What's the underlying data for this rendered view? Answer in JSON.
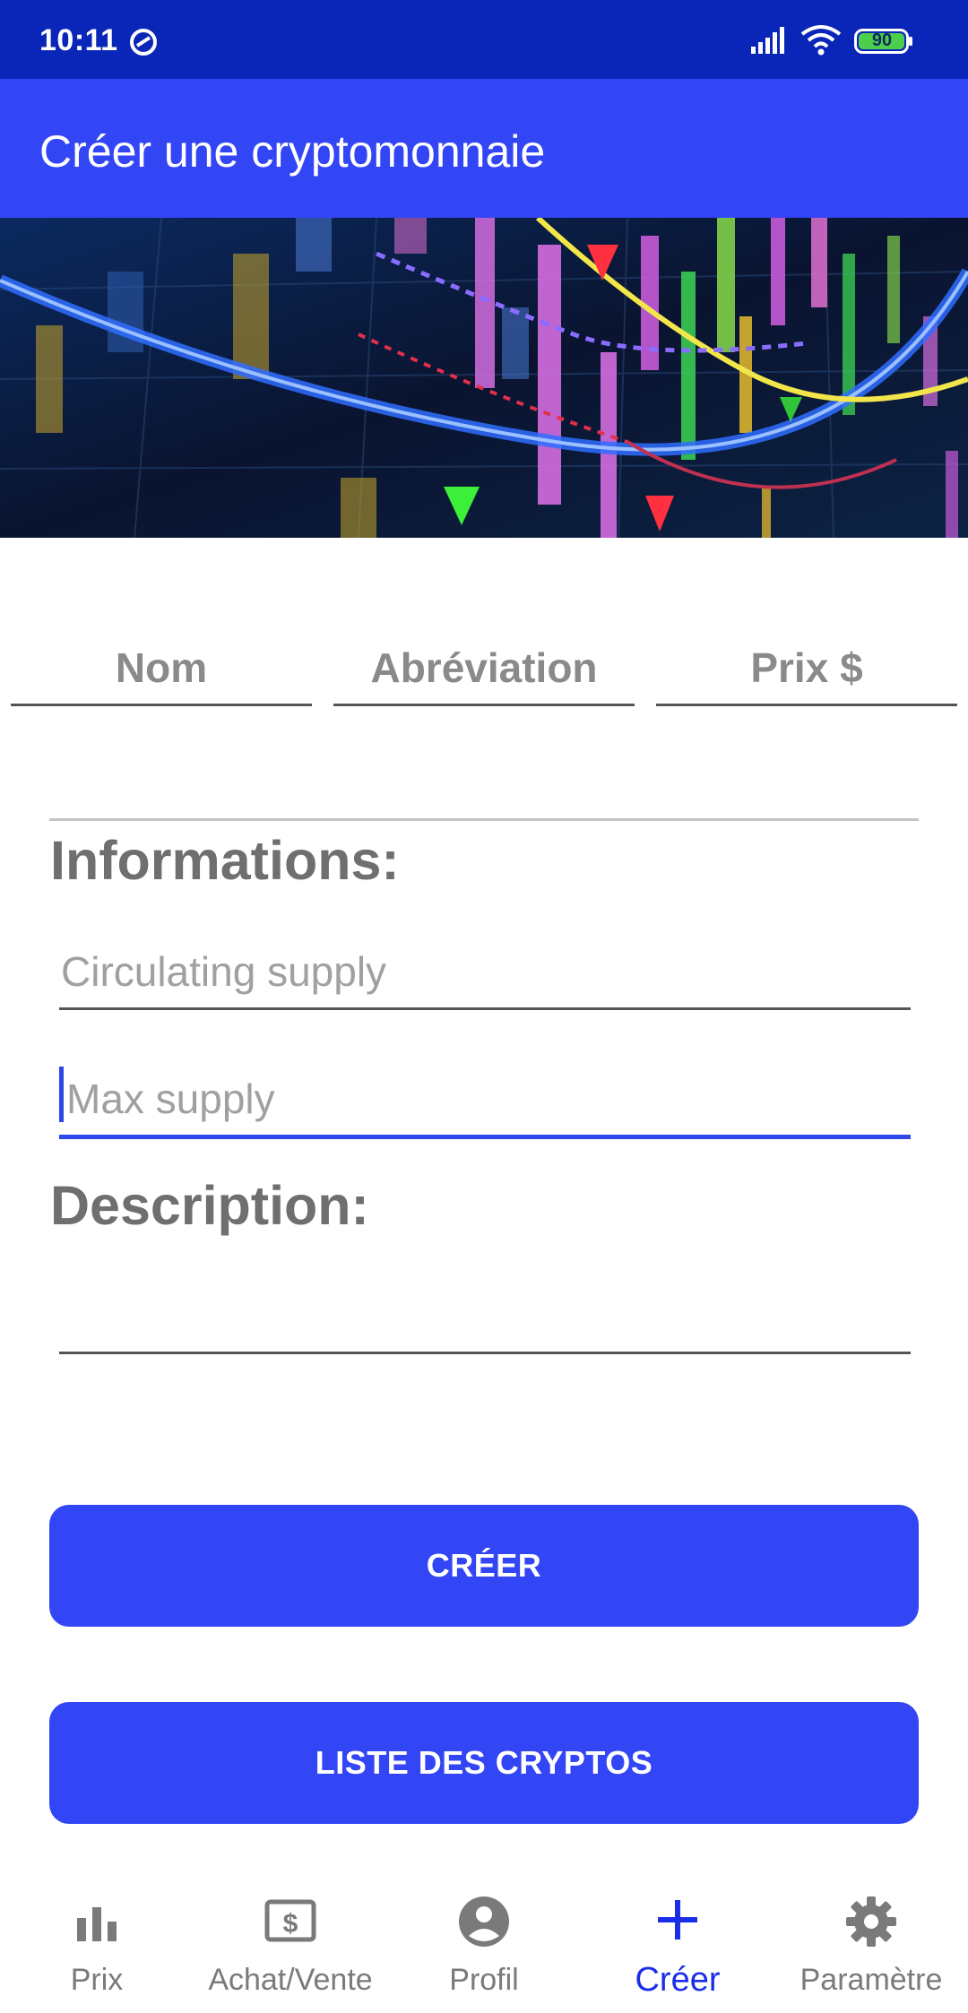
{
  "status_bar": {
    "time": "10:11",
    "battery_level": "90",
    "icons": [
      "dnd-icon",
      "signal-icon",
      "wifi-icon",
      "battery-icon"
    ]
  },
  "app_bar": {
    "title": "Créer une cryptomonnaie"
  },
  "form": {
    "name_placeholder": "Nom",
    "abbreviation_placeholder": "Abréviation",
    "price_placeholder": "Prix $",
    "informations_title": "Informations:",
    "circulating_supply_placeholder": "Circulating supply",
    "max_supply_placeholder": "Max supply",
    "description_title": "Description:",
    "description_value": ""
  },
  "buttons": {
    "create": "CRÉER",
    "crypto_list": "LISTE DES CRYPTOS"
  },
  "bottom_nav": {
    "items": [
      {
        "label": "Prix",
        "icon": "bar-chart-icon",
        "active": false
      },
      {
        "label": "Achat/Vente",
        "icon": "dollar-card-icon",
        "active": false
      },
      {
        "label": "Profil",
        "icon": "account-circle-icon",
        "active": false
      },
      {
        "label": "Créer",
        "icon": "plus-icon",
        "active": true
      },
      {
        "label": "Paramètre",
        "icon": "gear-icon",
        "active": false
      }
    ]
  },
  "colors": {
    "status_bar": "#0a26b8",
    "primary": "#3346f5",
    "active_nav": "#1a2de8",
    "inactive_nav": "#7a7a7a"
  }
}
